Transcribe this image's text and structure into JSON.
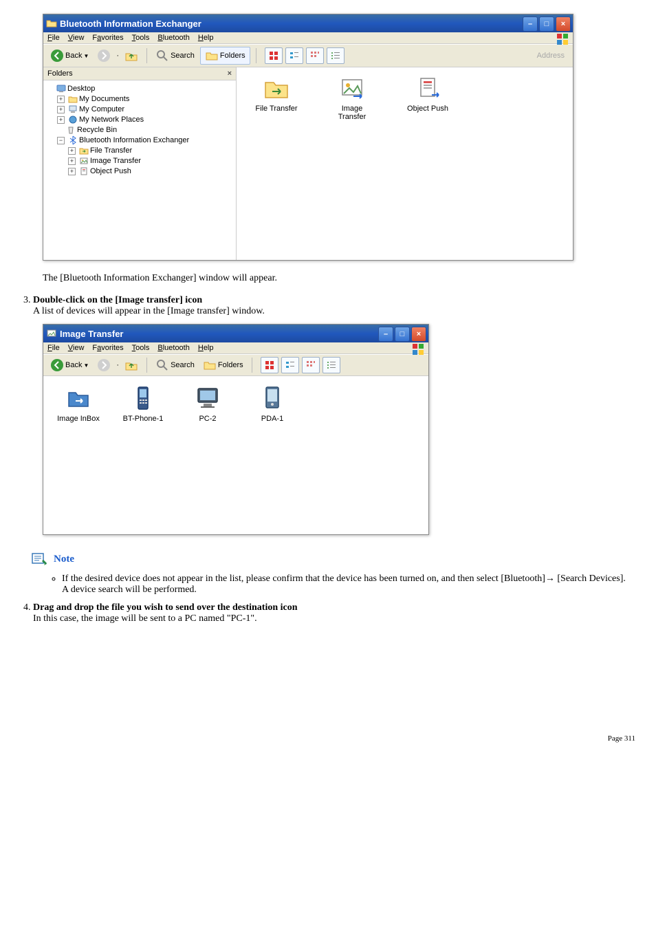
{
  "window1": {
    "title": "Bluetooth Information Exchanger",
    "menus": [
      "File",
      "View",
      "Favorites",
      "Tools",
      "Bluetooth",
      "Help"
    ],
    "menu_underline": [
      "F",
      "V",
      "a",
      "T",
      "B",
      "H"
    ],
    "toolbar": {
      "back": "Back",
      "search": "Search",
      "folders": "Folders",
      "address": "Address"
    },
    "folders_pane_title": "Folders",
    "tree": {
      "desktop": "Desktop",
      "mydocs": "My Documents",
      "mycomp": "My Computer",
      "mynet": "My Network Places",
      "recycle": "Recycle Bin",
      "bie": "Bluetooth Information Exchanger",
      "ft": "File Transfer",
      "it": "Image Transfer",
      "op": "Object Push"
    },
    "content": {
      "file_transfer": "File Transfer",
      "image_transfer": "Image Transfer",
      "image_transfer2": "",
      "it_line2": "",
      "object_push": "Object Push"
    }
  },
  "caption1": "The [Bluetooth Information Exchanger] window will appear.",
  "step3": {
    "title": "Double-click on the [Image transfer] icon",
    "sub": "A list of devices will appear in the [Image transfer] window."
  },
  "window2": {
    "title": "Image Transfer",
    "menus": [
      "File",
      "View",
      "Favorites",
      "Tools",
      "Bluetooth",
      "Help"
    ],
    "toolbar": {
      "back": "Back",
      "search": "Search",
      "folders": "Folders"
    },
    "items": [
      "Image InBox",
      "BT-Phone-1",
      "PC-2",
      "PDA-1"
    ]
  },
  "note_label": "Note",
  "note_bullet": "If the desired device does not appear in the list, please confirm that the device has been turned on, and then select [Bluetooth]→ [Search Devices].",
  "note_bullet_line2": "A device search will be performed.",
  "step4": {
    "title": "Drag and drop the file you wish to send over the destination icon",
    "sub": "In this case, the image will be sent to a PC named \"PC-1\"."
  },
  "page_footer": "Page 311"
}
